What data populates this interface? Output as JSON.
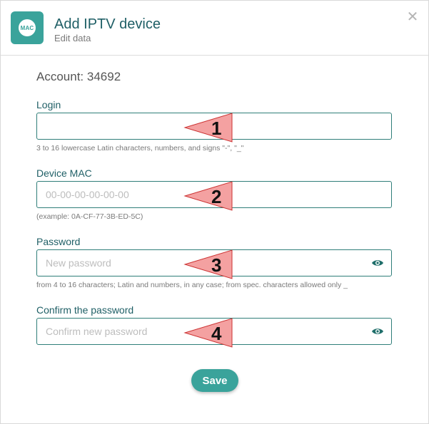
{
  "header": {
    "logo_text": "MAC",
    "title": "Add IPTV device",
    "subtitle": "Edit data",
    "close_glyph": "✕"
  },
  "account": {
    "label": "Account:",
    "value": "34692"
  },
  "fields": [
    {
      "label": "Login",
      "value": "",
      "placeholder": "",
      "hint": "3 to 16 lowercase Latin characters, numbers, and signs \"-\", \"_\"",
      "marker": "1"
    },
    {
      "label": "Device MAC",
      "value": "",
      "placeholder": "00-00-00-00-00-00",
      "hint": "(example: 0A-CF-77-3B-ED-5C)",
      "marker": "2"
    },
    {
      "label": "Password",
      "value": "",
      "placeholder": "New password",
      "hint": "from 4 to 16 characters; Latin and numbers, in any case; from spec. characters allowed only _",
      "marker": "3",
      "icon": "eye-icon"
    },
    {
      "label": "Confirm the password",
      "value": "",
      "placeholder": "Confirm new password",
      "hint": "",
      "marker": "4",
      "icon": "eye-icon"
    }
  ],
  "save_label": "Save",
  "colors": {
    "accent": "#3aa39b",
    "title": "#1f5f66",
    "marker_fill": "#f4a1a1"
  }
}
